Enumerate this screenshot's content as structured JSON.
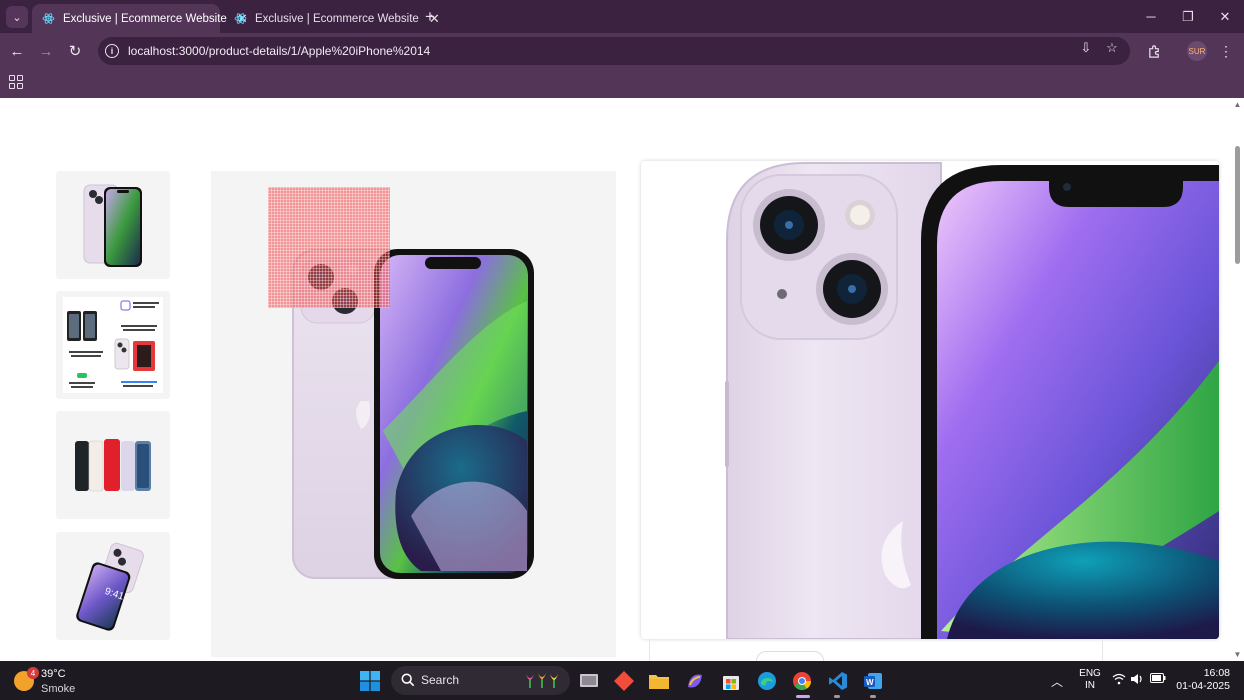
{
  "browser": {
    "tabs": [
      {
        "title": "Exclusive | Ecommerce Website",
        "active": true
      },
      {
        "title": "Exclusive | Ecommerce Website",
        "active": false
      }
    ],
    "url": "localhost:3000/product-details/1/Apple%20iPhone%2014",
    "profile_initials": "SUR"
  },
  "product": {
    "thumbnails": [
      {
        "name": "front-back-view"
      },
      {
        "name": "feature-collage"
      },
      {
        "name": "color-lineup"
      },
      {
        "name": "angled-view",
        "screen_time": "9:41"
      }
    ],
    "collage_text": {
      "left_top": "Always-on Retina",
      "middle": "Natural Image",
      "right": "Pro-level camera",
      "bottom_left": "Great Battery",
      "bottom_right": "Crash Detection"
    },
    "colors": [
      "#1f2429",
      "#f3ede7",
      "#e0202a",
      "#dcd6ea",
      "#5c7fa4"
    ]
  },
  "taskbar": {
    "weather": {
      "temp": "39°C",
      "condition": "Smoke",
      "badge": "4"
    },
    "search_label": "Search",
    "lang": [
      "ENG",
      "IN"
    ],
    "time": "16:08",
    "date": "01-04-2025"
  },
  "colors": {
    "tab_strip": "#3b2240",
    "toolbar": "#533558",
    "taskbar": "#1e1a21",
    "lens": "#f04646"
  }
}
